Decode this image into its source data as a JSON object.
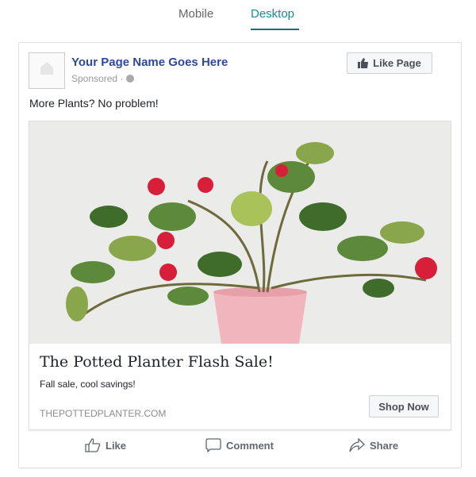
{
  "tabs": [
    {
      "label": "Mobile",
      "active": false
    },
    {
      "label": "Desktop",
      "active": true
    }
  ],
  "accent_color": "#1a8a93",
  "post": {
    "page_name": "Your Page Name Goes Here",
    "sponsored": "Sponsored",
    "like_page_label": "Like Page",
    "text": "More Plants? No problem!",
    "ad": {
      "headline": "The Potted Planter Flash Sale!",
      "description": "Fall sale, cool savings!",
      "domain": "THEPOTTEDPLANTER.COM",
      "cta_label": "Shop Now"
    },
    "actions": [
      {
        "label": "Like",
        "icon": "thumbs-up-icon"
      },
      {
        "label": "Comment",
        "icon": "comment-icon"
      },
      {
        "label": "Share",
        "icon": "share-icon"
      }
    ]
  }
}
